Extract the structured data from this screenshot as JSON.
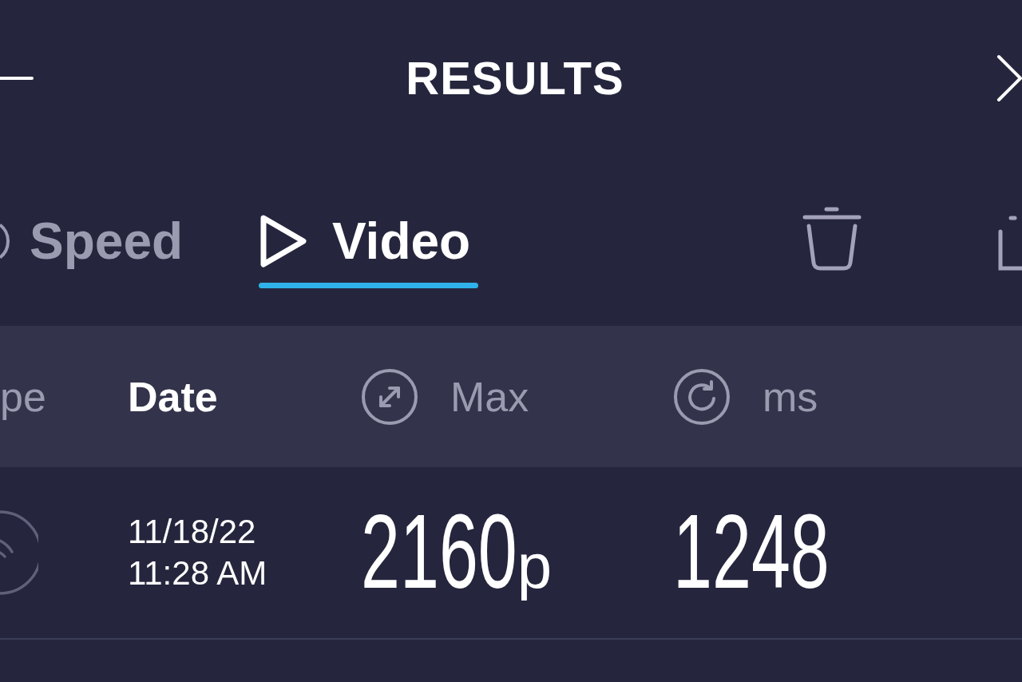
{
  "top_bar": {
    "title": "RESULTS"
  },
  "tabs": [
    {
      "label": "Speed",
      "selected": false
    },
    {
      "label": "Video",
      "selected": true
    }
  ],
  "table": {
    "columns": [
      {
        "label": "pe",
        "selected": false
      },
      {
        "label": "Date",
        "selected": true
      },
      {
        "label": "Max",
        "selected": false
      },
      {
        "label": "ms",
        "selected": false
      }
    ],
    "rows": [
      {
        "date": "11/18/22",
        "time": "11:28 AM",
        "max": "2160",
        "max_unit": "p",
        "ms": "1248"
      }
    ]
  }
}
